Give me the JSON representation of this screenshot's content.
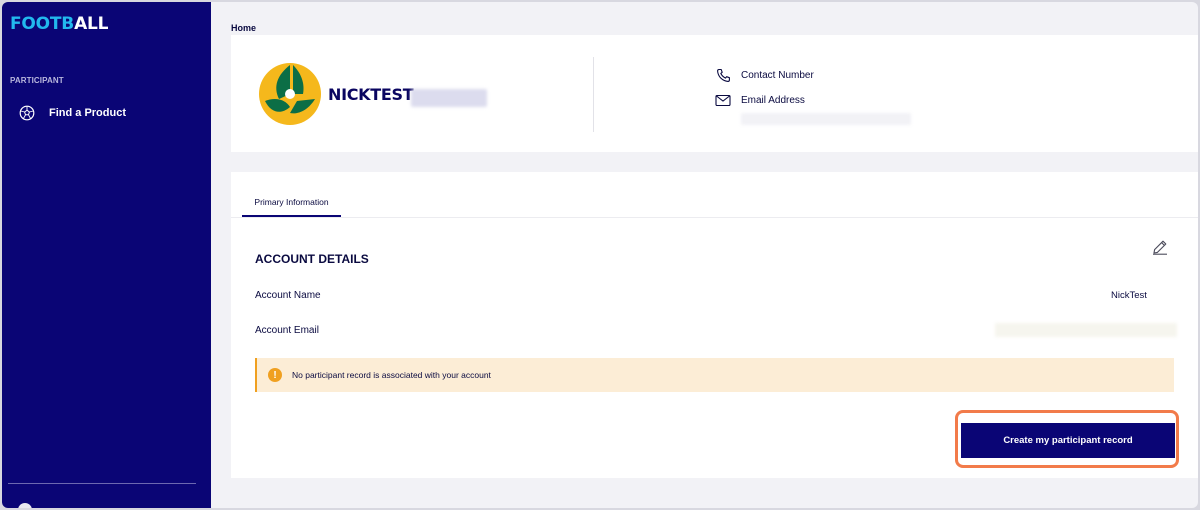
{
  "sidebar": {
    "logo_part1": "FOOTB",
    "logo_part2": "ALL",
    "section_label": "PARTICIPANT",
    "items": [
      {
        "label": "Find a Product",
        "icon": "soccer-ball-icon"
      }
    ]
  },
  "breadcrumb": "Home",
  "profile": {
    "club_name": "NICKTEST",
    "contact_number_label": "Contact Number",
    "email_address_label": "Email Address"
  },
  "tabs": [
    {
      "label": "Primary Information",
      "active": true
    }
  ],
  "account": {
    "section_title": "ACCOUNT DETAILS",
    "name_label": "Account Name",
    "name_value": "NickTest",
    "email_label": "Account Email",
    "alert_text": "No participant record is associated with your account",
    "create_button_label": "Create my participant record"
  },
  "colors": {
    "sidebar_bg": "#0a0575",
    "accent_blue": "#22b8ee",
    "alert_bg": "#fcedd6",
    "alert_icon": "#f0a020",
    "highlight_ring": "#f27b4a"
  }
}
